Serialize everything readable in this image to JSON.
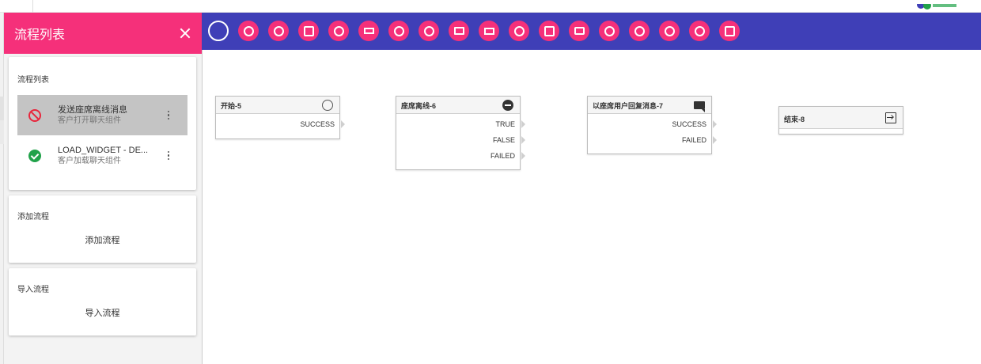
{
  "panel": {
    "title": "流程列表",
    "flows_card_title": "流程列表",
    "flows": [
      {
        "name": "发送座席离线消息",
        "sub": "客户打开聊天组件",
        "status": "disabled"
      },
      {
        "name": "LOAD_WIDGET - DE...",
        "sub": "客户加载聊天组件",
        "status": "enabled"
      }
    ],
    "add_card_title": "添加流程",
    "add_button": "添加流程",
    "import_card_title": "导入流程",
    "import_button": "导入流程"
  },
  "toolbar": {
    "tools": [
      "start-icon",
      "drop-icon",
      "drop-alt-icon",
      "contact-icon",
      "minus-circle-icon",
      "filter-icon",
      "globe-icon",
      "headset-icon",
      "mail-icon",
      "list-icon",
      "help-icon",
      "search-doc-icon",
      "chat-icon",
      "fork-icon",
      "stopwatch-icon",
      "clock-icon",
      "add-group-icon",
      "exit-icon"
    ]
  },
  "nodes": [
    {
      "title": "开始-5",
      "icon": "circle",
      "ports": [
        "SUCCESS"
      ]
    },
    {
      "title": "座席离线-6",
      "icon": "minus",
      "ports": [
        "TRUE",
        "FALSE",
        "FAILED"
      ]
    },
    {
      "title": "以座席用户回复消息-7",
      "icon": "chat",
      "ports": [
        "SUCCESS",
        "FAILED"
      ]
    },
    {
      "title": "结束-8",
      "icon": "exit",
      "ports": []
    }
  ],
  "colors": {
    "accent": "#f5307a",
    "toolbar": "#3f3fb7",
    "ok": "#21a24a",
    "ban": "#e8263c"
  }
}
